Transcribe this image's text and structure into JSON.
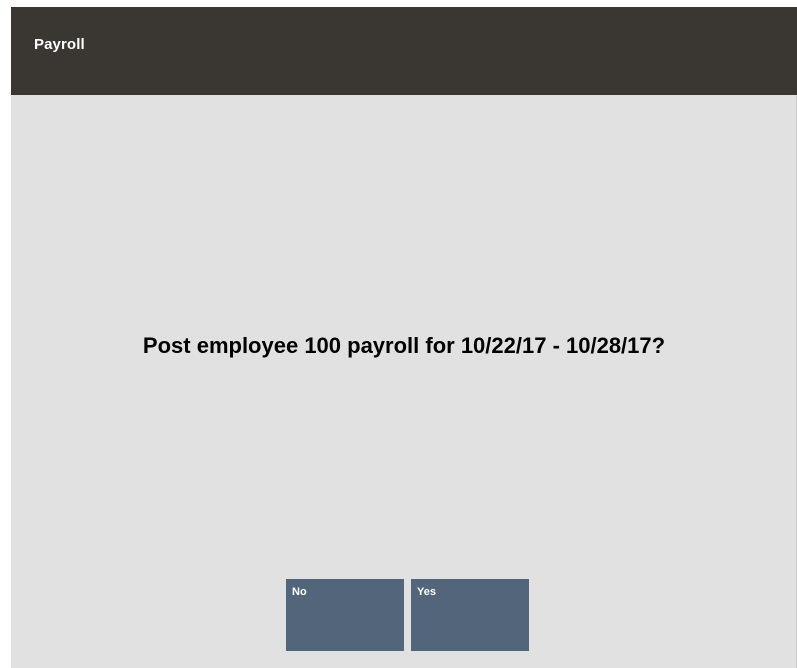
{
  "window": {
    "title": "Payroll"
  },
  "dialog": {
    "prompt": "Post employee 100 payroll for 10/22/17 - 10/28/17?"
  },
  "buttons": {
    "no_label": "No",
    "yes_label": "Yes"
  },
  "colors": {
    "title_bar": "#3a3632",
    "background": "#e1e1e1",
    "button": "#52657b"
  }
}
